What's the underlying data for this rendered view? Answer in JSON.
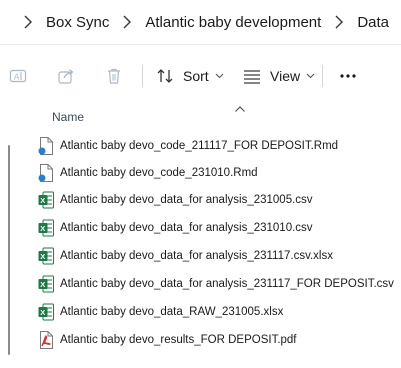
{
  "breadcrumb": {
    "items": [
      {
        "label": "Box Sync"
      },
      {
        "label": "Atlantic baby development"
      },
      {
        "label": "Data"
      }
    ]
  },
  "toolbar": {
    "sort_label": "Sort",
    "view_label": "View",
    "more_label": "···"
  },
  "header": {
    "name_label": "Name"
  },
  "files": [
    {
      "name": "Atlantic baby devo_code_211117_FOR DEPOSIT.Rmd",
      "icon": "rmd-file-icon"
    },
    {
      "name": "Atlantic baby devo_code_231010.Rmd",
      "icon": "rmd-file-icon"
    },
    {
      "name": "Atlantic baby devo_data_for analysis_231005.csv",
      "icon": "excel-file-icon"
    },
    {
      "name": "Atlantic baby devo_data_for analysis_231010.csv",
      "icon": "excel-file-icon"
    },
    {
      "name": "Atlantic baby devo_data_for analysis_231117.csv.xlsx",
      "icon": "excel-file-icon"
    },
    {
      "name": "Atlantic baby devo_data_for analysis_231117_FOR DEPOSIT.csv",
      "icon": "excel-file-icon"
    },
    {
      "name": "Atlantic baby devo_data_RAW_231005.xlsx",
      "icon": "excel-file-icon"
    },
    {
      "name": "Atlantic baby devo_results_FOR DEPOSIT.pdf",
      "icon": "pdf-file-icon"
    }
  ],
  "colors": {
    "excel_green": "#1d7a45",
    "pdf_red": "#d13438",
    "rmd_blue": "#2b7cd3",
    "disabled_icon": "#a9b8c8"
  }
}
